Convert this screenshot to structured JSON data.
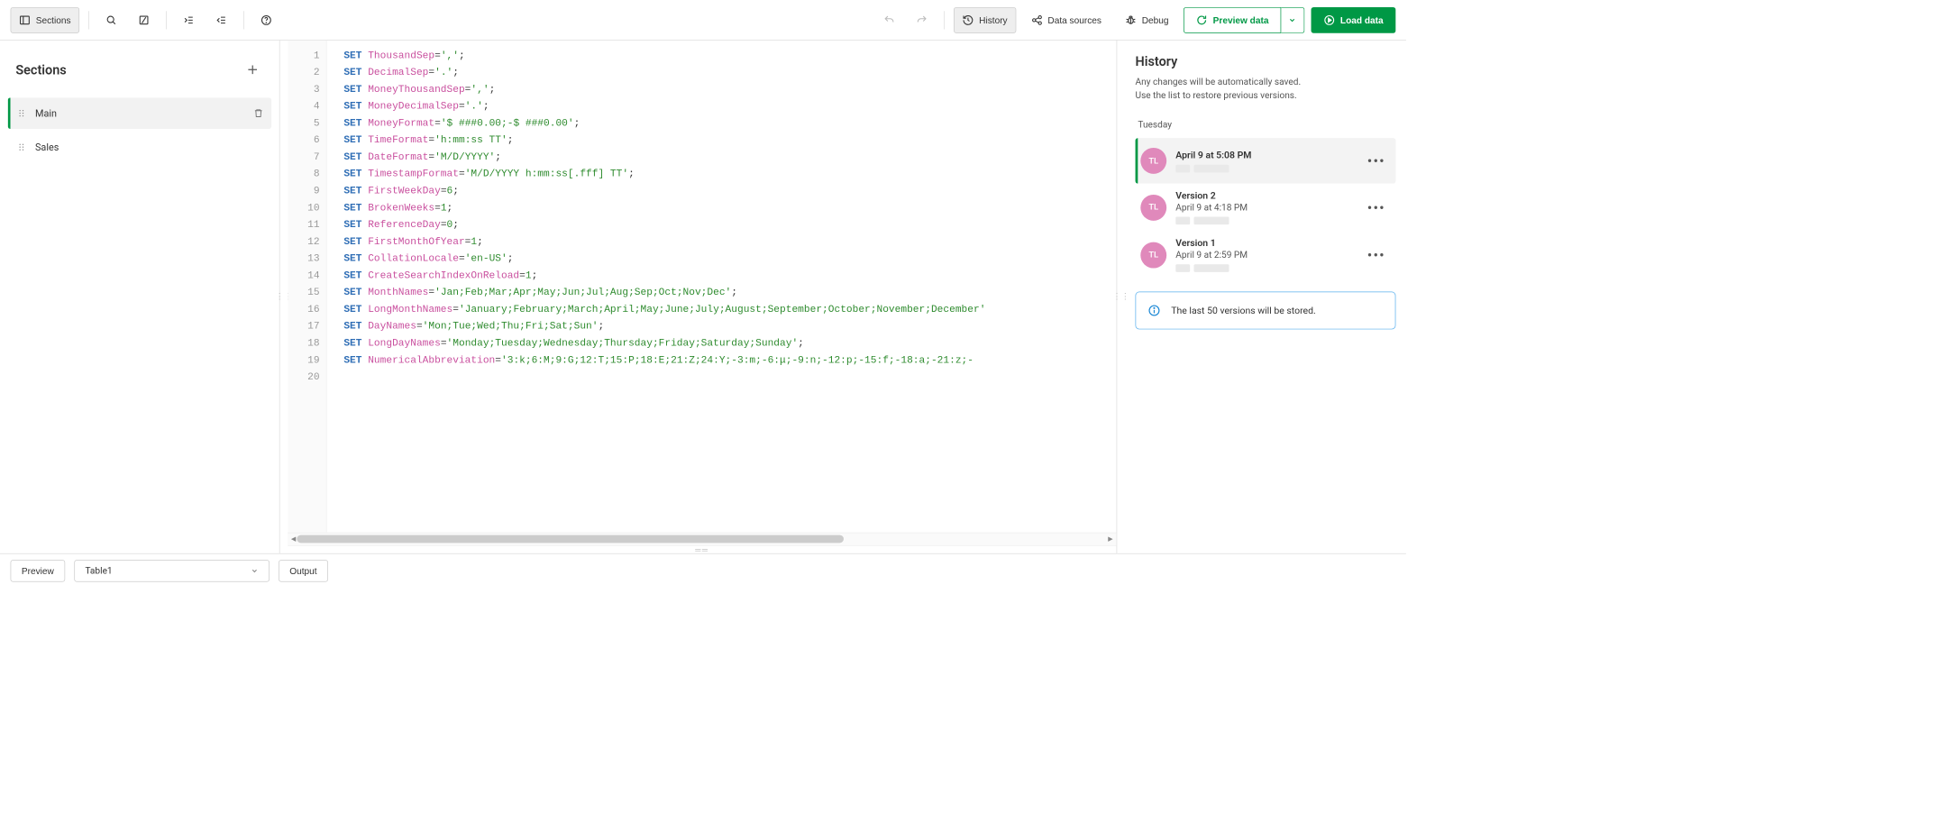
{
  "toolbar": {
    "sections_label": "Sections",
    "history_label": "History",
    "data_sources_label": "Data sources",
    "debug_label": "Debug",
    "preview_data_label": "Preview data",
    "load_data_label": "Load data"
  },
  "sidebar": {
    "title": "Sections",
    "items": [
      {
        "label": "Main",
        "active": true
      },
      {
        "label": "Sales",
        "active": false
      }
    ]
  },
  "code": {
    "lines": [
      {
        "n": 1,
        "kw": "SET",
        "var": "ThousandSep",
        "rest": "=','",
        "str": true,
        "suffix": ";"
      },
      {
        "n": 2,
        "kw": "SET",
        "var": "DecimalSep",
        "rest": "='.'",
        "str": true,
        "suffix": ";"
      },
      {
        "n": 3,
        "kw": "SET",
        "var": "MoneyThousandSep",
        "rest": "=','",
        "str": true,
        "suffix": ";"
      },
      {
        "n": 4,
        "kw": "SET",
        "var": "MoneyDecimalSep",
        "rest": "='.'",
        "str": true,
        "suffix": ";"
      },
      {
        "n": 5,
        "kw": "SET",
        "var": "MoneyFormat",
        "rest": "='$ ###0.00;-$ ###0.00'",
        "str": true,
        "suffix": ";"
      },
      {
        "n": 6,
        "kw": "SET",
        "var": "TimeFormat",
        "rest": "='h:mm:ss TT'",
        "str": true,
        "suffix": ";"
      },
      {
        "n": 7,
        "kw": "SET",
        "var": "DateFormat",
        "rest": "='M/D/YYYY'",
        "str": true,
        "suffix": ";"
      },
      {
        "n": 8,
        "kw": "SET",
        "var": "TimestampFormat",
        "rest": "='M/D/YYYY h:mm:ss[.fff] TT'",
        "str": true,
        "suffix": ";"
      },
      {
        "n": 9,
        "kw": "SET",
        "var": "FirstWeekDay",
        "rest": "=6",
        "str": false,
        "suffix": ";"
      },
      {
        "n": 10,
        "kw": "SET",
        "var": "BrokenWeeks",
        "rest": "=1",
        "str": false,
        "suffix": ";"
      },
      {
        "n": 11,
        "kw": "SET",
        "var": "ReferenceDay",
        "rest": "=0",
        "str": false,
        "suffix": ";"
      },
      {
        "n": 12,
        "kw": "SET",
        "var": "FirstMonthOfYear",
        "rest": "=1",
        "str": false,
        "suffix": ";"
      },
      {
        "n": 13,
        "kw": "SET",
        "var": "CollationLocale",
        "rest": "='en-US'",
        "str": true,
        "suffix": ";"
      },
      {
        "n": 14,
        "kw": "SET",
        "var": "CreateSearchIndexOnReload",
        "rest": "=1",
        "str": false,
        "suffix": ";"
      },
      {
        "n": 15,
        "kw": "SET",
        "var": "MonthNames",
        "rest": "='Jan;Feb;Mar;Apr;May;Jun;Jul;Aug;Sep;Oct;Nov;Dec'",
        "str": true,
        "suffix": ";"
      },
      {
        "n": 16,
        "kw": "SET",
        "var": "LongMonthNames",
        "rest": "='January;February;March;April;May;June;July;August;September;October;November;December'",
        "str": true,
        "suffix": ""
      },
      {
        "n": 17,
        "kw": "SET",
        "var": "DayNames",
        "rest": "='Mon;Tue;Wed;Thu;Fri;Sat;Sun'",
        "str": true,
        "suffix": ";"
      },
      {
        "n": 18,
        "kw": "SET",
        "var": "LongDayNames",
        "rest": "='Monday;Tuesday;Wednesday;Thursday;Friday;Saturday;Sunday'",
        "str": true,
        "suffix": ";"
      },
      {
        "n": 19,
        "kw": "SET",
        "var": "NumericalAbbreviation",
        "rest": "='3:k;6:M;9:G;12:T;15:P;18:E;21:Z;24:Y;-3:m;-6:μ;-9:n;-12:p;-15:f;-18:a;-21:z;-",
        "str": true,
        "suffix": ""
      },
      {
        "n": 20,
        "kw": "",
        "var": "",
        "rest": "",
        "str": false,
        "suffix": ""
      }
    ]
  },
  "history": {
    "title": "History",
    "desc1": "Any changes will be automatically saved.",
    "desc2": "Use the list to restore previous versions.",
    "day_label": "Tuesday",
    "avatar_initials": "TL",
    "items": [
      {
        "title": "April 9 at 5:08 PM",
        "sub": "",
        "active": true
      },
      {
        "title": "Version 2",
        "sub": "April 9 at 4:18 PM",
        "active": false
      },
      {
        "title": "Version 1",
        "sub": "April 9 at 2:59 PM",
        "active": false
      }
    ],
    "info": "The last 50 versions will be stored."
  },
  "bottom": {
    "preview_label": "Preview",
    "table_placeholder": "Table1",
    "output_label": "Output"
  }
}
